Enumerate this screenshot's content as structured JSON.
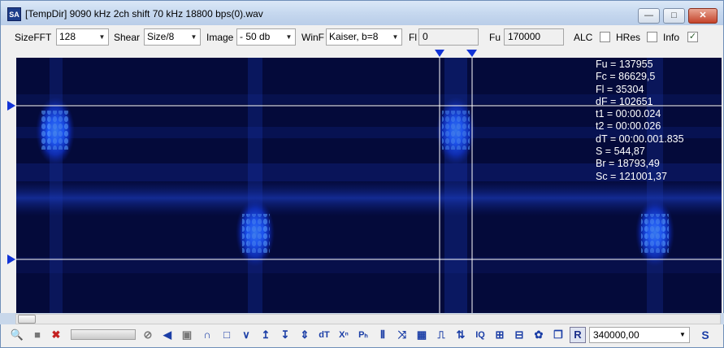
{
  "window": {
    "app_icon_text": "SA",
    "title": "[TempDir] 9090 kHz 2ch shift 70 kHz 18800 bps(0).wav",
    "minimize": "—",
    "maximize": "□",
    "close": "✕"
  },
  "toolbar": {
    "sizefft_label": "SizeFFT",
    "sizefft_value": "128",
    "shear_label": "Shear",
    "shear_value": "Size/8",
    "image_label": "Image",
    "image_value": "- 50 db",
    "winf_label": "WinF",
    "winf_value": "Kaiser, b=8",
    "fl_label": "Fl",
    "fl_value": "0",
    "fu_label": "Fu",
    "fu_value": "170000",
    "alc_label": "ALC",
    "alc_checked": false,
    "hres_label": "HRes",
    "hres_checked": false,
    "info_label": "Info",
    "info_checked": true,
    "dropdown_arrow": "▼",
    "check_mark": "✓"
  },
  "info": [
    "Fu = 137955",
    "Fc = 86629,5",
    "Fl = 35304",
    "dF = 102651",
    "t1 = 00:00.024",
    "t2 = 00:00.026",
    "dT = 00:00.001.835",
    "S = 544,87",
    "Br = 18793,49",
    "Sc = 121001,37"
  ],
  "bottom": {
    "rate_value": "340000,00",
    "r_label": "R",
    "s_label": "S",
    "icons": [
      {
        "name": "zoom-icon",
        "glyph": "🔍"
      },
      {
        "name": "stop-icon",
        "glyph": "■"
      },
      {
        "name": "delete-icon",
        "glyph": "✖"
      },
      {
        "name": "no-icon",
        "glyph": "⊘"
      },
      {
        "name": "speaker-icon",
        "glyph": "◀"
      },
      {
        "name": "square-icon",
        "glyph": "▣"
      },
      {
        "name": "arc-icon",
        "glyph": "∩"
      },
      {
        "name": "rect-icon",
        "glyph": "□"
      },
      {
        "name": "v-icon",
        "glyph": "∨"
      },
      {
        "name": "marker-up-icon",
        "glyph": "↥"
      },
      {
        "name": "marker-down-icon",
        "glyph": "↧"
      },
      {
        "name": "marker-both-icon",
        "glyph": "⇕"
      },
      {
        "name": "dt-icon",
        "glyph": "dT"
      },
      {
        "name": "xn-icon",
        "glyph": "Xⁿ"
      },
      {
        "name": "ph-icon",
        "glyph": "Pₕ"
      },
      {
        "name": "bars-icon",
        "glyph": "⦀"
      },
      {
        "name": "cross-icon",
        "glyph": "⤨"
      },
      {
        "name": "grid-icon",
        "glyph": "▦"
      },
      {
        "name": "pulse-icon",
        "glyph": "⎍"
      },
      {
        "name": "sort-icon",
        "glyph": "⇅"
      },
      {
        "name": "iq-icon",
        "glyph": "IQ"
      },
      {
        "name": "wave1-icon",
        "glyph": "⊞"
      },
      {
        "name": "wave2-icon",
        "glyph": "⊟"
      },
      {
        "name": "gear-icon",
        "glyph": "✿"
      },
      {
        "name": "copy-icon",
        "glyph": "❐"
      }
    ]
  }
}
